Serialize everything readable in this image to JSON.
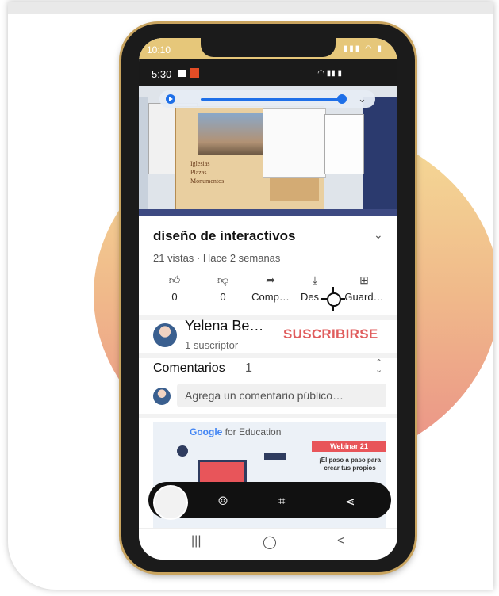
{
  "status": {
    "outer_time": "10:10",
    "inner_time": "5:30"
  },
  "player": {
    "play_icon": "play-icon",
    "chevron_icon": "chevron-down-icon"
  },
  "slide": {
    "lines": [
      "Iglesias",
      "Plazas",
      "Monumentos"
    ]
  },
  "video": {
    "title": "diseño de interactivos",
    "meta": "21 vistas · Hace 2 semanas"
  },
  "actions": [
    {
      "icon": "thumbs-up-icon",
      "label": "0"
    },
    {
      "icon": "thumbs-down-icon",
      "label": "0"
    },
    {
      "icon": "share-icon",
      "label": "Comp…"
    },
    {
      "icon": "download-icon",
      "label": "Des…"
    },
    {
      "icon": "save-icon",
      "label": "Guard…"
    }
  ],
  "channel": {
    "name": "Yelena Be…",
    "subs": "1 suscriptor",
    "subscribe": "SUSCRIBIRSE"
  },
  "comments": {
    "label": "Comentarios",
    "count": "1",
    "placeholder": "Agrega un comentario público…"
  },
  "next_video": {
    "brand": "Google",
    "brand_suffix": " for Education",
    "badge": "Webinar 21",
    "text": "¡El paso a paso para crear tus propios"
  },
  "screenshot_toolbar": {
    "icons": [
      "scroll-capture-icon",
      "crop-edit-icon",
      "share-icon"
    ]
  },
  "nav": {
    "recent": "|||",
    "home": "◯",
    "back": "<"
  },
  "colors": {
    "accent": "#1e6fe8",
    "subscribe": "#e05d5d",
    "gold": "#c9a45f"
  }
}
